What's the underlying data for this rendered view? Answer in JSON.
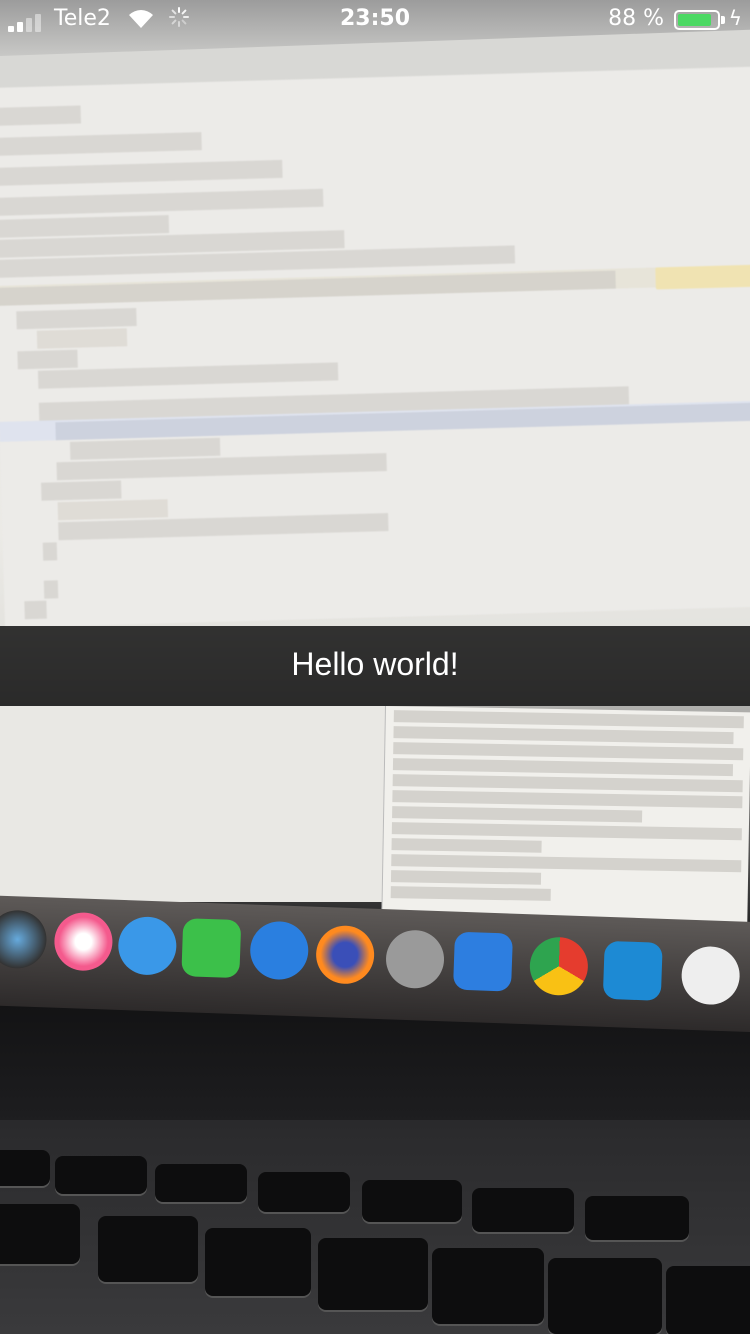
{
  "status_bar": {
    "carrier": "Tele2",
    "time": "23:50",
    "battery_percent_label": "88 %",
    "battery_level": 0.88,
    "battery_color": "#4cd964"
  },
  "caption": {
    "text": "Hello world!"
  },
  "background_icons": {
    "signal": "signal-bars-icon",
    "wifi": "wifi-icon",
    "activity": "activity-spinner-icon",
    "charging": "charging-bolt-icon"
  }
}
